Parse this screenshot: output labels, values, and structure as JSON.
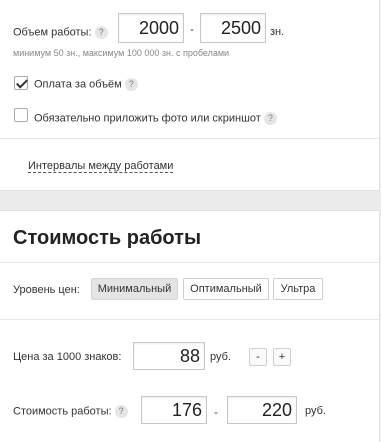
{
  "volume": {
    "label": "Объем работы:",
    "from": "2000",
    "dash": "-",
    "to": "2500",
    "unit": "зн.",
    "hint": "минимум 50 зн., максимум 100 000 зн. с пробелами"
  },
  "pay_per_volume": {
    "label": "Оплата за объём",
    "checked": true
  },
  "photo_required": {
    "label": "Обязательно приложить фото или скриншот",
    "checked": false
  },
  "help_glyph": "?",
  "intervals_link": "Интервалы между работами",
  "cost": {
    "title": "Стоимость работы",
    "price_level_label": "Уровень цен:",
    "price_levels": [
      "Минимальный",
      "Оптимальный",
      "Ультра"
    ],
    "selected_level": "Минимальный",
    "price_per_1000_label": "Цена за 1000 знаков:",
    "price_per_1000": "88",
    "currency": "руб.",
    "minus": "-",
    "plus": "+",
    "work_cost_label": "Стоимость работы:",
    "work_cost_from": "176",
    "work_cost_dash": "-",
    "work_cost_to": "220"
  }
}
